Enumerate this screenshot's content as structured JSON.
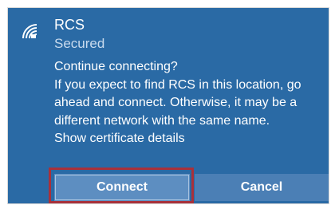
{
  "network": {
    "name": "RCS",
    "status": "Secured",
    "icon": "wifi-secured-icon"
  },
  "message": {
    "lines": [
      "Continue connecting?",
      "If you expect to find RCS in this location, go",
      "ahead and connect. Otherwise, it may be a",
      "different network with the same name."
    ],
    "cert_link": "Show certificate details"
  },
  "buttons": {
    "connect_label": "Connect",
    "cancel_label": "Cancel"
  },
  "colors": {
    "panel_bg": "#2a6aa5",
    "connect_bg": "#5d8ec1",
    "cancel_bg": "#4b7fb5",
    "highlight": "#a8313b"
  }
}
